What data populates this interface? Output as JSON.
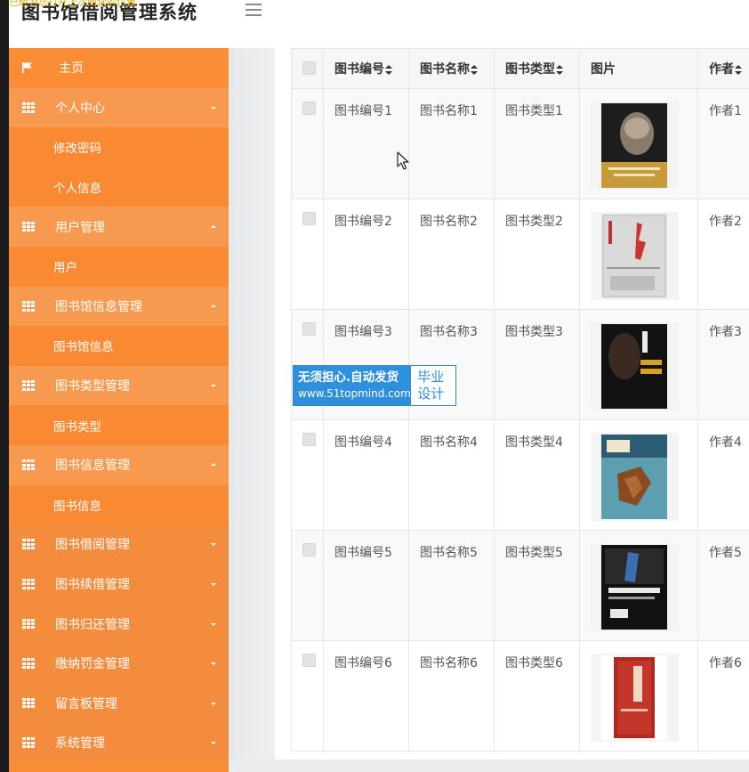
{
  "app": {
    "title": "图书馆借阅管理系统",
    "overlay_text": "已经为您打开上次阅读的位置"
  },
  "sidebar": {
    "items": [
      {
        "label": "主页",
        "type": "home",
        "icon": "flag-icon"
      },
      {
        "label": "个人中心",
        "type": "parent",
        "open": true,
        "icon": "grid-icon"
      },
      {
        "label": "修改密码",
        "type": "child"
      },
      {
        "label": "个人信息",
        "type": "child"
      },
      {
        "label": "用户管理",
        "type": "parent",
        "open": true,
        "icon": "grid-icon"
      },
      {
        "label": "用户",
        "type": "child"
      },
      {
        "label": "图书馆信息管理",
        "type": "parent",
        "open": true,
        "icon": "grid-icon"
      },
      {
        "label": "图书馆信息",
        "type": "child"
      },
      {
        "label": "图书类型管理",
        "type": "parent",
        "open": true,
        "icon": "grid-icon"
      },
      {
        "label": "图书类型",
        "type": "child"
      },
      {
        "label": "图书信息管理",
        "type": "parent",
        "open": true,
        "icon": "grid-icon"
      },
      {
        "label": "图书信息",
        "type": "child"
      },
      {
        "label": "图书借阅管理",
        "type": "parent",
        "open": false,
        "icon": "grid-icon"
      },
      {
        "label": "图书续借管理",
        "type": "parent",
        "open": false,
        "icon": "grid-icon"
      },
      {
        "label": "图书归还管理",
        "type": "parent",
        "open": false,
        "icon": "grid-icon"
      },
      {
        "label": "缴纳罚金管理",
        "type": "parent",
        "open": false,
        "icon": "grid-icon"
      },
      {
        "label": "留言板管理",
        "type": "parent",
        "open": false,
        "icon": "grid-icon"
      },
      {
        "label": "系统管理",
        "type": "parent",
        "open": false,
        "icon": "grid-icon"
      }
    ]
  },
  "table": {
    "headers": {
      "id": "图书编号",
      "name": "图书名称",
      "type": "图书类型",
      "image": "图片",
      "author": "作者"
    },
    "rows": [
      {
        "id": "图书编号1",
        "name": "图书名称1",
        "type": "图书类型1",
        "author": "作者1",
        "cover": "cover-1"
      },
      {
        "id": "图书编号2",
        "name": "图书名称2",
        "type": "图书类型2",
        "author": "作者2",
        "cover": "cover-2"
      },
      {
        "id": "图书编号3",
        "name": "图书名称3",
        "type": "图书类型3",
        "author": "作者3",
        "cover": "cover-3"
      },
      {
        "id": "图书编号4",
        "name": "图书名称4",
        "type": "图书类型4",
        "author": "作者4",
        "cover": "cover-4"
      },
      {
        "id": "图书编号5",
        "name": "图书名称5",
        "type": "图书类型5",
        "author": "作者5",
        "cover": "cover-5"
      },
      {
        "id": "图书编号6",
        "name": "图书名称6",
        "type": "图书类型6",
        "author": "作者6",
        "cover": "cover-6"
      }
    ]
  },
  "watermark": {
    "line1": "无须担心.自动发货",
    "line2": "www.51topmind.com",
    "right_line1": "毕业",
    "right_line2": "设计"
  },
  "colors": {
    "sidebar_bg": "#f98c34",
    "sidebar_open_parent": "#f79a50",
    "watermark_blue": "#2e8fdc"
  }
}
